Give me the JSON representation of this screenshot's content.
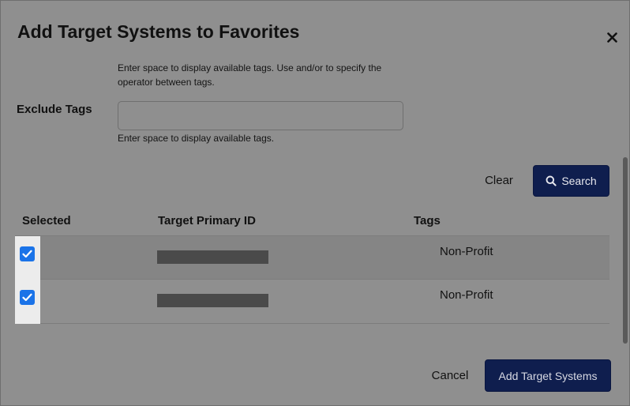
{
  "dialog": {
    "title": "Add Target Systems to Favorites",
    "close_symbol": "✕"
  },
  "include_tags": {
    "help": "Enter space to display available tags. Use and/or to specify the operator between tags."
  },
  "exclude_tags": {
    "label": "Exclude Tags",
    "value": "",
    "placeholder": "",
    "help": "Enter space to display available tags."
  },
  "actions": {
    "clear_label": "Clear",
    "search_label": "Search"
  },
  "table": {
    "headers": {
      "selected": "Selected",
      "target_primary_id": "Target Primary ID",
      "tags": "Tags"
    },
    "rows": [
      {
        "selected": true,
        "tags": "Non-Profit"
      },
      {
        "selected": true,
        "tags": "Non-Profit"
      }
    ]
  },
  "footer": {
    "cancel_label": "Cancel",
    "add_label": "Add Target Systems"
  },
  "icons": {
    "close": "close-icon",
    "search": "search-icon",
    "check": "checkmark-icon"
  },
  "colors": {
    "primary_button": "#0f1e4e",
    "checkbox": "#1a73e8",
    "overlay": "#8f8f8f"
  }
}
